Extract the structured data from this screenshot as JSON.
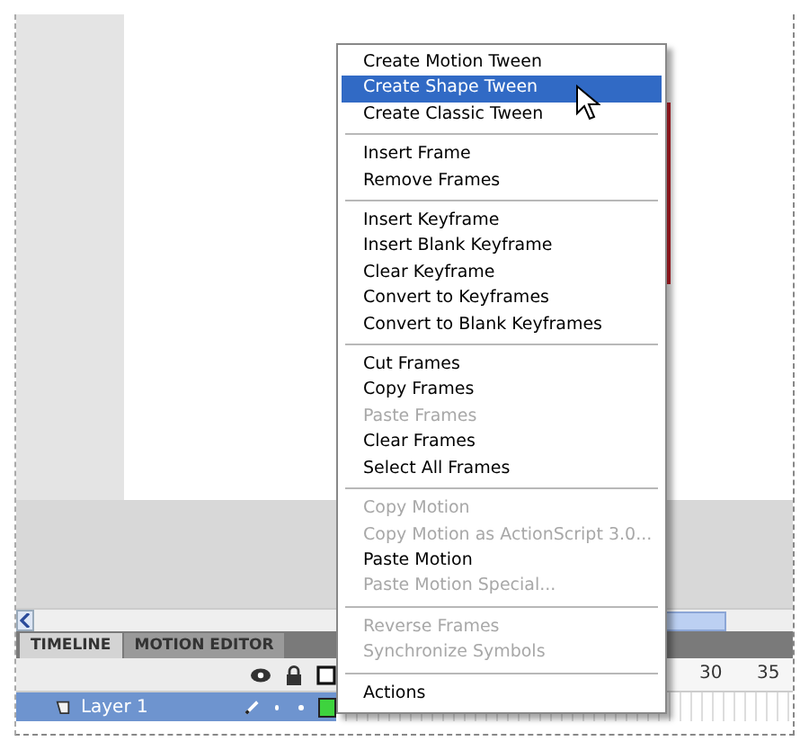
{
  "tabs": [
    {
      "label": "TIMELINE",
      "selected": true
    },
    {
      "label": "MOTION EDITOR",
      "selected": false
    }
  ],
  "layers": [
    {
      "name": "Layer 1",
      "selected": true
    }
  ],
  "frame_numbers": [
    "30",
    "35"
  ],
  "context_menu": {
    "items": [
      {
        "kind": "item",
        "label": "Create Motion Tween",
        "disabled": false,
        "selected": false
      },
      {
        "kind": "item",
        "label": "Create Shape Tween",
        "disabled": false,
        "selected": true
      },
      {
        "kind": "item",
        "label": "Create Classic Tween",
        "disabled": false,
        "selected": false
      },
      {
        "kind": "separator"
      },
      {
        "kind": "item",
        "label": "Insert Frame",
        "disabled": false,
        "selected": false
      },
      {
        "kind": "item",
        "label": "Remove Frames",
        "disabled": false,
        "selected": false
      },
      {
        "kind": "separator"
      },
      {
        "kind": "item",
        "label": "Insert Keyframe",
        "disabled": false,
        "selected": false
      },
      {
        "kind": "item",
        "label": "Insert Blank Keyframe",
        "disabled": false,
        "selected": false
      },
      {
        "kind": "item",
        "label": "Clear Keyframe",
        "disabled": false,
        "selected": false
      },
      {
        "kind": "item",
        "label": "Convert to Keyframes",
        "disabled": false,
        "selected": false
      },
      {
        "kind": "item",
        "label": "Convert to Blank Keyframes",
        "disabled": false,
        "selected": false
      },
      {
        "kind": "separator"
      },
      {
        "kind": "item",
        "label": "Cut Frames",
        "disabled": false,
        "selected": false
      },
      {
        "kind": "item",
        "label": "Copy Frames",
        "disabled": false,
        "selected": false
      },
      {
        "kind": "item",
        "label": "Paste Frames",
        "disabled": true,
        "selected": false
      },
      {
        "kind": "item",
        "label": "Clear Frames",
        "disabled": false,
        "selected": false
      },
      {
        "kind": "item",
        "label": "Select All Frames",
        "disabled": false,
        "selected": false
      },
      {
        "kind": "separator"
      },
      {
        "kind": "item",
        "label": "Copy Motion",
        "disabled": true,
        "selected": false
      },
      {
        "kind": "item",
        "label": "Copy Motion as ActionScript 3.0...",
        "disabled": true,
        "selected": false
      },
      {
        "kind": "item",
        "label": "Paste Motion",
        "disabled": false,
        "selected": false
      },
      {
        "kind": "item",
        "label": "Paste Motion Special...",
        "disabled": true,
        "selected": false
      },
      {
        "kind": "separator"
      },
      {
        "kind": "item",
        "label": "Reverse Frames",
        "disabled": true,
        "selected": false
      },
      {
        "kind": "item",
        "label": "Synchronize Symbols",
        "disabled": true,
        "selected": false
      },
      {
        "kind": "separator"
      },
      {
        "kind": "item",
        "label": "Actions",
        "disabled": false,
        "selected": false
      }
    ]
  }
}
